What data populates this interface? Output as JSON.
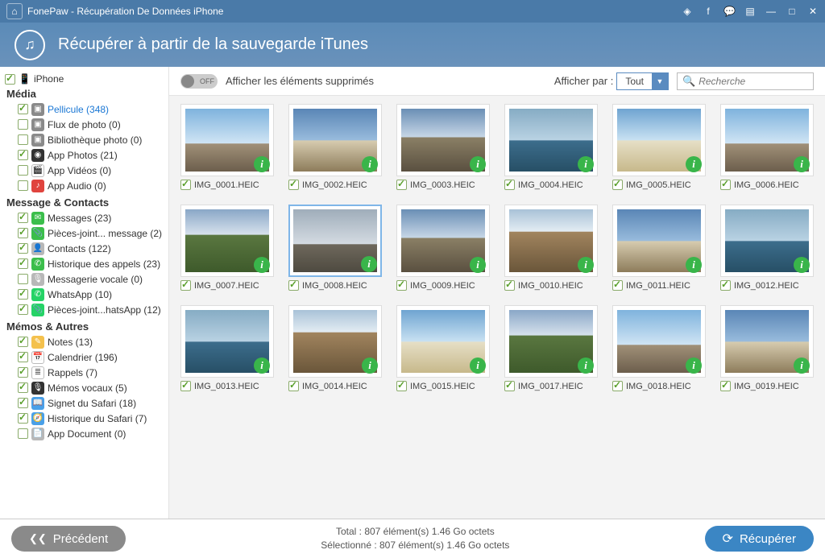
{
  "titlebar": {
    "title": "FonePaw - Récupération De Données iPhone"
  },
  "banner": {
    "heading": "Récupérer à partir de la sauvegarde iTunes"
  },
  "device": {
    "label": "iPhone"
  },
  "sidebar": {
    "groups": [
      {
        "header": "Média",
        "items": [
          {
            "name": "pellicule",
            "label": "Pellicule (348)",
            "checked": true,
            "active": true,
            "iconBg": "#8a8a8a",
            "glyph": "▣"
          },
          {
            "name": "flux-photo",
            "label": "Flux de photo (0)",
            "checked": false,
            "iconBg": "#8a8a8a",
            "glyph": "▣"
          },
          {
            "name": "bibliotheque-photo",
            "label": "Bibliothèque photo (0)",
            "checked": false,
            "iconBg": "#8a8a8a",
            "glyph": "▣"
          },
          {
            "name": "app-photos",
            "label": "App Photos (21)",
            "checked": true,
            "iconBg": "#333",
            "glyph": "◉"
          },
          {
            "name": "app-videos",
            "label": "App Vidéos (0)",
            "checked": false,
            "iconBg": "#fff",
            "glyph": "🎬"
          },
          {
            "name": "app-audio",
            "label": "App Audio (0)",
            "checked": false,
            "iconBg": "#e0443e",
            "glyph": "♪"
          }
        ]
      },
      {
        "header": "Message & Contacts",
        "items": [
          {
            "name": "messages",
            "label": "Messages (23)",
            "checked": true,
            "iconBg": "#3bbe4b",
            "glyph": "✉"
          },
          {
            "name": "pj-message",
            "label": "Pièces-joint... message (2)",
            "checked": true,
            "iconBg": "#3bbe4b",
            "glyph": "📎"
          },
          {
            "name": "contacts",
            "label": "Contacts (122)",
            "checked": true,
            "iconBg": "#b8b8b8",
            "glyph": "👤"
          },
          {
            "name": "historique-appels",
            "label": "Historique des appels (23)",
            "checked": true,
            "iconBg": "#3bbe4b",
            "glyph": "✆"
          },
          {
            "name": "messagerie-vocale",
            "label": "Messagerie vocale (0)",
            "checked": false,
            "iconBg": "#b8b8b8",
            "glyph": "🎙"
          },
          {
            "name": "whatsapp",
            "label": "WhatsApp (10)",
            "checked": true,
            "iconBg": "#25d366",
            "glyph": "✆"
          },
          {
            "name": "pj-whatsapp",
            "label": "Pièces-joint...hatsApp (12)",
            "checked": true,
            "iconBg": "#25d366",
            "glyph": "📎"
          }
        ]
      },
      {
        "header": "Mémos & Autres",
        "items": [
          {
            "name": "notes",
            "label": "Notes (13)",
            "checked": true,
            "iconBg": "#f4c14d",
            "glyph": "✎"
          },
          {
            "name": "calendrier",
            "label": "Calendrier (196)",
            "checked": true,
            "iconBg": "#fff",
            "glyph": "📅"
          },
          {
            "name": "rappels",
            "label": "Rappels (7)",
            "checked": true,
            "iconBg": "#fff",
            "glyph": "≣"
          },
          {
            "name": "memos-vocaux",
            "label": "Mémos vocaux (5)",
            "checked": true,
            "iconBg": "#333",
            "glyph": "🎙"
          },
          {
            "name": "signet-safari",
            "label": "Signet du Safari (18)",
            "checked": true,
            "iconBg": "#4aa0e8",
            "glyph": "📖"
          },
          {
            "name": "historique-safari",
            "label": "Historique du Safari (7)",
            "checked": true,
            "iconBg": "#4aa0e8",
            "glyph": "🧭"
          },
          {
            "name": "app-document",
            "label": "App Document (0)",
            "checked": false,
            "iconBg": "#b8b8b8",
            "glyph": "📄"
          }
        ]
      }
    ]
  },
  "toolbar": {
    "toggle_state": "OFF",
    "toggle_label": "Afficher les éléments supprimés",
    "displayby_label": "Afficher par :",
    "displayby_value": "Tout",
    "search_placeholder": "Recherche"
  },
  "grid": {
    "items": [
      {
        "file": "IMG_0001.HEIC",
        "cls": "sky1",
        "selected": false
      },
      {
        "file": "IMG_0002.HEIC",
        "cls": "sky2",
        "selected": false
      },
      {
        "file": "IMG_0003.HEIC",
        "cls": "sky3",
        "selected": false
      },
      {
        "file": "IMG_0004.HEIC",
        "cls": "water",
        "selected": false
      },
      {
        "file": "IMG_0005.HEIC",
        "cls": "beach",
        "selected": false
      },
      {
        "file": "IMG_0006.HEIC",
        "cls": "sky1",
        "selected": false
      },
      {
        "file": "IMG_0007.HEIC",
        "cls": "green",
        "selected": false
      },
      {
        "file": "IMG_0008.HEIC",
        "cls": "pier",
        "selected": true
      },
      {
        "file": "IMG_0009.HEIC",
        "cls": "sky3",
        "selected": false
      },
      {
        "file": "IMG_0010.HEIC",
        "cls": "rock",
        "selected": false
      },
      {
        "file": "IMG_0011.HEIC",
        "cls": "sky2",
        "selected": false
      },
      {
        "file": "IMG_0012.HEIC",
        "cls": "water",
        "selected": false
      },
      {
        "file": "IMG_0013.HEIC",
        "cls": "water",
        "selected": false
      },
      {
        "file": "IMG_0014.HEIC",
        "cls": "rock",
        "selected": false
      },
      {
        "file": "IMG_0015.HEIC",
        "cls": "beach",
        "selected": false
      },
      {
        "file": "IMG_0017.HEIC",
        "cls": "green",
        "selected": false
      },
      {
        "file": "IMG_0018.HEIC",
        "cls": "sky1",
        "selected": false
      },
      {
        "file": "IMG_0019.HEIC",
        "cls": "sky2",
        "selected": false
      }
    ]
  },
  "footer": {
    "prev_label": "Précédent",
    "total_line": "Total : 807 élément(s) 1.46 Go octets",
    "selected_line": "Sélectionné : 807 élément(s) 1.46 Go octets",
    "recover_label": "Récupérer"
  }
}
